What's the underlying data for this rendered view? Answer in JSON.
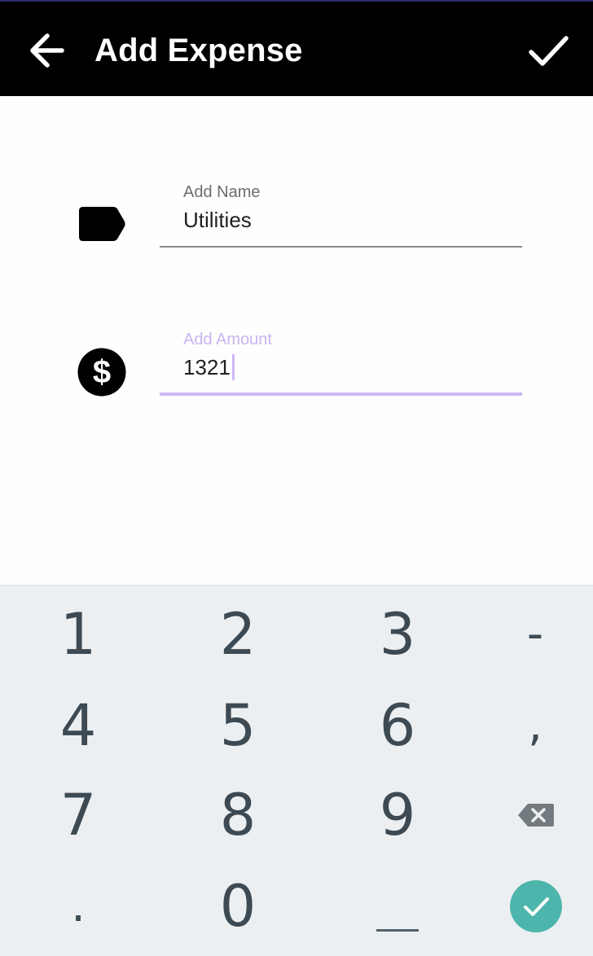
{
  "appbar": {
    "title": "Add Expense",
    "back_icon": "arrow-left-icon",
    "confirm_icon": "check-icon"
  },
  "form": {
    "name": {
      "label": "Add Name",
      "value": "Utilities",
      "icon": "tag-icon"
    },
    "amount": {
      "label": "Add Amount",
      "value": "1321",
      "icon": "dollar-circle-icon",
      "focused": true
    }
  },
  "keyboard": {
    "keys": {
      "k1": "1",
      "k2": "2",
      "k3": "3",
      "k4": "4",
      "k5": "5",
      "k6": "6",
      "k7": "7",
      "k8": "8",
      "k9": "9",
      "k0": "0",
      "minus": "-",
      "comma": ",",
      "period": "."
    },
    "backspace_icon": "backspace-icon",
    "space_icon": "space-bar-icon",
    "enter_icon": "check-circle-icon"
  },
  "colors": {
    "appbar_bg": "#000000",
    "accent_focus": "#cdb7f6",
    "keyboard_bg": "#eceff1",
    "key_text": "#3d4a53",
    "enter_button": "#4db6ac"
  }
}
